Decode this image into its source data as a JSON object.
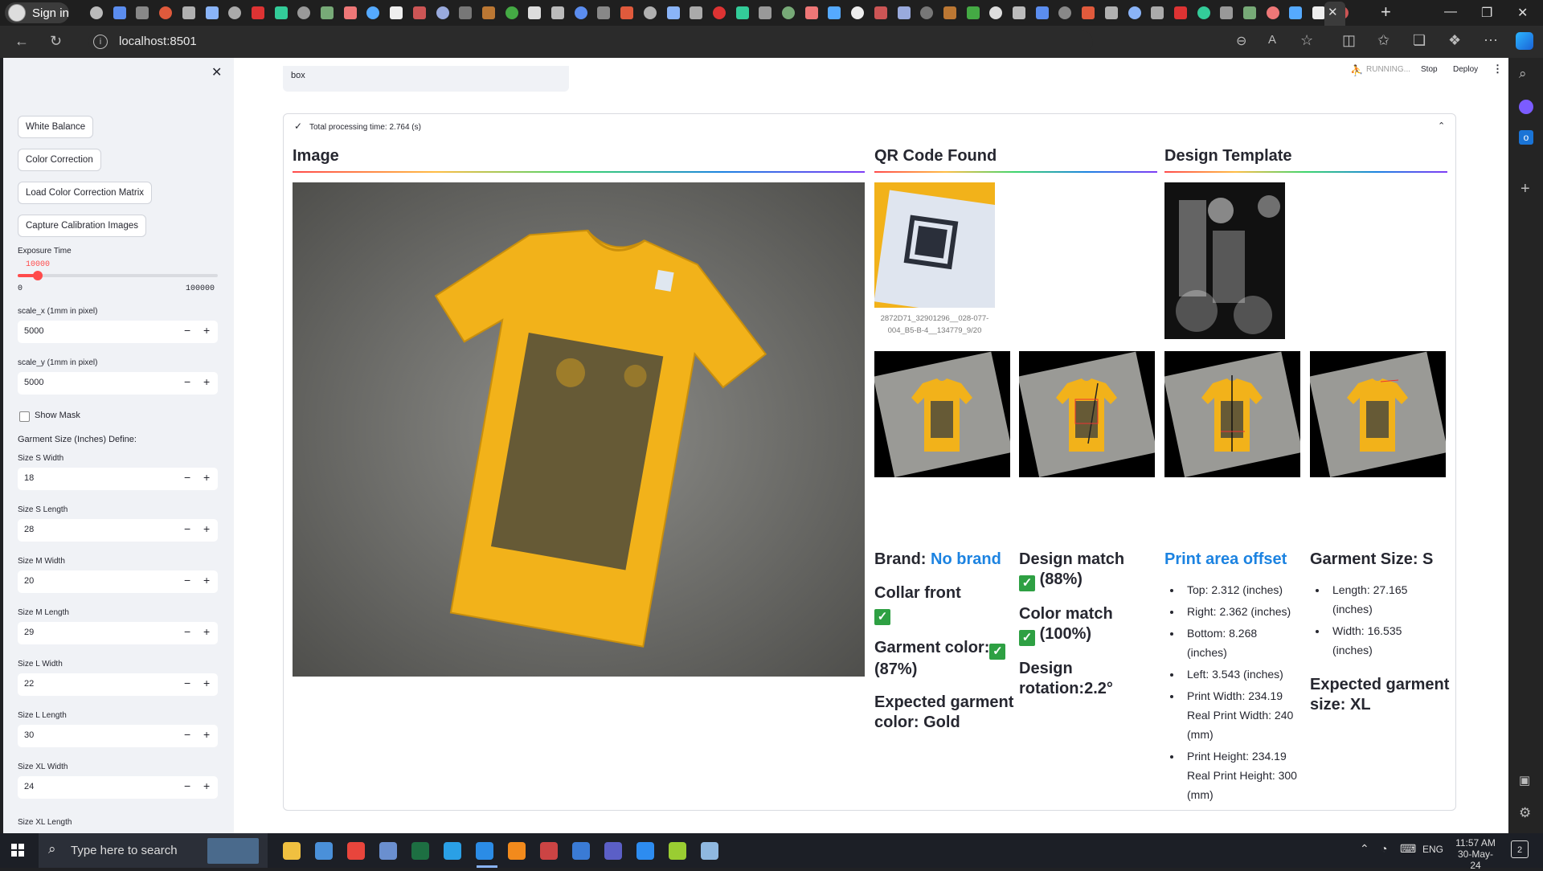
{
  "browser": {
    "signin_label": "Sign in",
    "url": "localhost:8501"
  },
  "app": {
    "status": "RUNNING...",
    "stop_label": "Stop",
    "deploy_label": "Deploy",
    "selectbox_value": "box",
    "processing_time": "Total processing time: 2.764 (s)"
  },
  "sidebar": {
    "buttons": [
      "White Balance",
      "Color Correction",
      "Load Color Correction Matrix",
      "Capture Calibration Images"
    ],
    "exposure": {
      "label": "Exposure Time",
      "value": "10000",
      "min": "0",
      "max": "100000",
      "fraction": 0.1
    },
    "scale_x": {
      "label": "scale_x (1mm in pixel)",
      "value": "5000"
    },
    "scale_y": {
      "label": "scale_y (1mm in pixel)",
      "value": "5000"
    },
    "show_mask": "Show Mask",
    "size_define_label": "Garment Size (Inches) Define:",
    "sizes": [
      {
        "label": "Size S Width",
        "value": "18"
      },
      {
        "label": "Size S Length",
        "value": "28"
      },
      {
        "label": "Size M Width",
        "value": "20"
      },
      {
        "label": "Size M Length",
        "value": "29"
      },
      {
        "label": "Size L Width",
        "value": "22"
      },
      {
        "label": "Size L Length",
        "value": "30"
      },
      {
        "label": "Size XL Width",
        "value": "24"
      }
    ],
    "last_label": "Size XL Length"
  },
  "results": {
    "image_heading": "Image",
    "qr_heading": "QR Code Found",
    "template_heading": "Design Template",
    "qr_caption": "2872D71_32901296__028-077-004_B5-B-4__134779_9/20",
    "brand_label": "Brand:",
    "brand_value": "No brand",
    "collar": "Collar front",
    "garment_color": "Garment color:",
    "garment_color_pct": "(87%)",
    "expected_color": "Expected garment color: Gold",
    "design_match": "Design match",
    "design_match_pct": "(88%)",
    "color_match": "Color match",
    "color_match_pct": "(100%)",
    "design_rotation": "Design rotation:2.2°",
    "print_offset_heading": "Print area offset",
    "offsets": [
      "Top: 2.312 (inches)",
      "Right: 2.362 (inches)",
      "Bottom: 8.268 (inches)",
      "Left: 3.543 (inches)",
      "Print Width: 234.19 Real Print Width: 240 (mm)",
      "Print Height: 234.19 Real Print Height: 300 (mm)"
    ],
    "garment_size_heading": "Garment Size: S",
    "garment_dims": [
      "Length: 27.165 (inches)",
      "Width: 16.535 (inches)"
    ],
    "expected_size": "Expected garment size: XL"
  },
  "taskbar": {
    "search_placeholder": "Type here to search",
    "lang": "ENG",
    "time": "11:57 AM",
    "date": "30-May-24",
    "notifications": "2"
  },
  "colors": {
    "accent": "#ff4b4b",
    "link": "#1c83e1",
    "check": "#2ea043",
    "shirt": "#f2b21a"
  }
}
